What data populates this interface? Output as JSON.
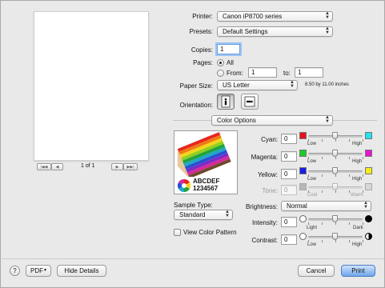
{
  "printer": {
    "label": "Printer:",
    "value": "Canon iP8700 series"
  },
  "presets": {
    "label": "Presets:",
    "value": "Default Settings"
  },
  "copies": {
    "label": "Copies:",
    "value": "1"
  },
  "pages": {
    "label": "Pages:",
    "all": "All",
    "from": "From:",
    "from_value": "1",
    "to": "to:",
    "to_value": "1"
  },
  "paper": {
    "label": "Paper Size:",
    "value": "US Letter",
    "dimensions": "8.50 by 11.00 inches"
  },
  "orientation": {
    "label": "Orientation:"
  },
  "section": {
    "value": "Color Options"
  },
  "preview": {
    "page_counter": "1 of 1",
    "sample_text1": "ABCDEF",
    "sample_text2": "1234567"
  },
  "sample_type": {
    "label": "Sample Type:",
    "value": "Standard",
    "view_pattern": "View Color Pattern"
  },
  "sliders": [
    {
      "name": "cyan",
      "label": "Cyan:",
      "value": "0",
      "low": "Low",
      "high": "High",
      "left_color": "#e8101a",
      "right_color": "#22e3ef"
    },
    {
      "name": "magenta",
      "label": "Magenta:",
      "value": "0",
      "low": "Low",
      "high": "High",
      "left_color": "#1bcc27",
      "right_color": "#e614cf"
    },
    {
      "name": "yellow",
      "label": "Yellow:",
      "value": "0",
      "low": "Low",
      "high": "High",
      "left_color": "#1b1ee0",
      "right_color": "#f4ee18"
    },
    {
      "name": "tone",
      "label": "Tone:",
      "value": "0",
      "low": "Cool",
      "high": "Warm",
      "left_color": "#b8b8b8",
      "right_color": "#d8d8d8"
    }
  ],
  "brightness": {
    "label": "Brightness:",
    "value": "Normal"
  },
  "intensity": {
    "label": "Intensity:",
    "value": "0",
    "low": "Light",
    "high": "Dark"
  },
  "contrast": {
    "label": "Contrast:",
    "value": "0",
    "low": "Low",
    "high": "High"
  },
  "footer": {
    "help": "?",
    "pdf": "PDF",
    "hide_details": "Hide Details",
    "cancel": "Cancel",
    "print": "Print"
  }
}
